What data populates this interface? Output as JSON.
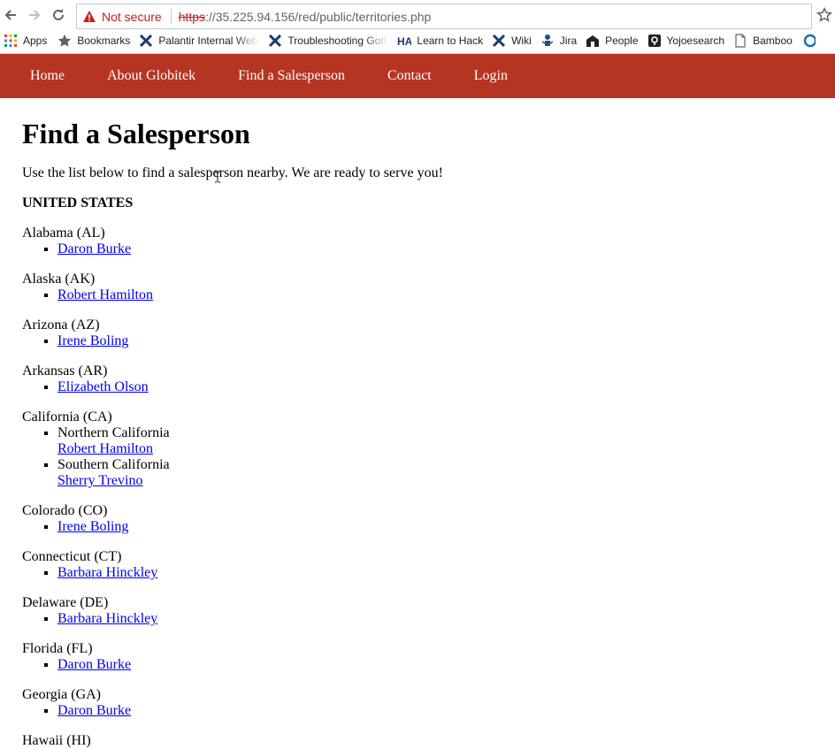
{
  "browser": {
    "security_label": "Not secure",
    "url_scheme": "https",
    "url_rest": "://35.225.94.156/red/public/territories.php",
    "bookmarks": [
      {
        "label": "Apps",
        "icon": "apps-grid-icon"
      },
      {
        "label": "Bookmarks",
        "icon": "star-icon"
      },
      {
        "label": "Palantir Internal Webs",
        "icon": "palantir-icon"
      },
      {
        "label": "Troubleshooting Goth",
        "icon": "palantir-icon"
      },
      {
        "label": "Learn to Hack",
        "icon": "ha-icon"
      },
      {
        "label": "Wiki",
        "icon": "palantir-icon"
      },
      {
        "label": "Jira",
        "icon": "jira-icon"
      },
      {
        "label": "People",
        "icon": "people-icon"
      },
      {
        "label": "Yojoesearch",
        "icon": "search-badge-icon"
      },
      {
        "label": "Bamboo",
        "icon": "page-icon"
      }
    ]
  },
  "colors": {
    "nav_bg": "#b63422",
    "link": "#0000ee",
    "warning": "#c5221f"
  },
  "nav": {
    "items": [
      "Home",
      "About Globitek",
      "Find a Salesperson",
      "Contact",
      "Login"
    ]
  },
  "page": {
    "title": "Find a Salesperson",
    "intro": "Use the list below to find a salesperson nearby. We are ready to serve you!",
    "country": "UNITED STATES",
    "states": [
      {
        "name": "Alabama (AL)",
        "reps": [
          "Daron Burke"
        ]
      },
      {
        "name": "Alaska (AK)",
        "reps": [
          "Robert Hamilton"
        ]
      },
      {
        "name": "Arizona (AZ)",
        "reps": [
          "Irene Boling"
        ]
      },
      {
        "name": "Arkansas (AR)",
        "reps": [
          "Elizabeth Olson"
        ]
      },
      {
        "name": "California (CA)",
        "regions": [
          {
            "name": "Northern California",
            "rep": "Robert Hamilton"
          },
          {
            "name": "Southern California",
            "rep": "Sherry Trevino"
          }
        ]
      },
      {
        "name": "Colorado (CO)",
        "reps": [
          "Irene Boling"
        ]
      },
      {
        "name": "Connecticut (CT)",
        "reps": [
          "Barbara Hinckley"
        ]
      },
      {
        "name": "Delaware (DE)",
        "reps": [
          "Barbara Hinckley"
        ]
      },
      {
        "name": "Florida (FL)",
        "reps": [
          "Daron Burke"
        ]
      },
      {
        "name": "Georgia (GA)",
        "reps": [
          "Daron Burke"
        ]
      },
      {
        "name": "Hawaii (HI)",
        "reps": []
      }
    ]
  }
}
